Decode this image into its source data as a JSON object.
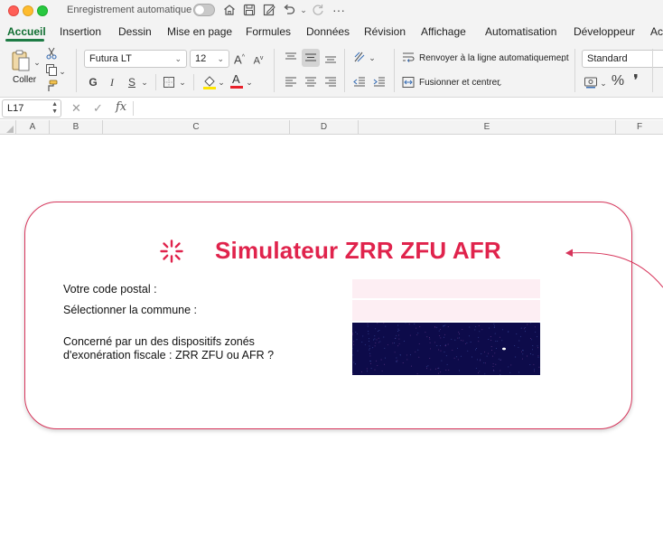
{
  "titlebar": {
    "autosave_label": "Enregistrement automatique",
    "icons": [
      "home-icon",
      "save-icon",
      "edit-icon",
      "undo-icon",
      "redo-icon",
      "more-icon"
    ]
  },
  "tabs": [
    {
      "label": "Accueil",
      "active": true
    },
    {
      "label": "Insertion"
    },
    {
      "label": "Dessin"
    },
    {
      "label": "Mise en page"
    },
    {
      "label": "Formules"
    },
    {
      "label": "Données"
    },
    {
      "label": "Révision"
    },
    {
      "label": "Affichage"
    },
    {
      "label": "Automatisation"
    },
    {
      "label": "Développeur"
    },
    {
      "label": "Accr"
    }
  ],
  "ribbon": {
    "paste_label": "Coller",
    "font_name": "Futura LT",
    "font_size": "12",
    "bold_label": "G",
    "italic_label": "I",
    "underline_label": "S",
    "wrap_text_label": "Renvoyer à la ligne automatiquement",
    "merge_center_label": "Fusionner et centrer",
    "number_format": "Standard",
    "percent_label": "%",
    "comma_label": "❜"
  },
  "formula_bar": {
    "name_box": "L17",
    "fx_label": "fx",
    "formula": ""
  },
  "columns": [
    "A",
    "B",
    "C",
    "D",
    "E",
    "F"
  ],
  "sheet": {
    "title": "Simulateur ZRR ZFU AFR",
    "postal_label": "Votre code postal :",
    "commune_label": "Sélectionner la commune :",
    "question_line1": "Concerné par un des dispositifs zonés",
    "question_line2": "d'exonération fiscale : ZRR ZFU ou AFR ?",
    "postal_value": "",
    "commune_value": ""
  },
  "colors": {
    "accent_tab": "#1e7c45",
    "title_red": "#e0234c",
    "card_border": "#d7355b",
    "input_fill": "#fdeef3",
    "result_fill": "#0d0b4a"
  }
}
